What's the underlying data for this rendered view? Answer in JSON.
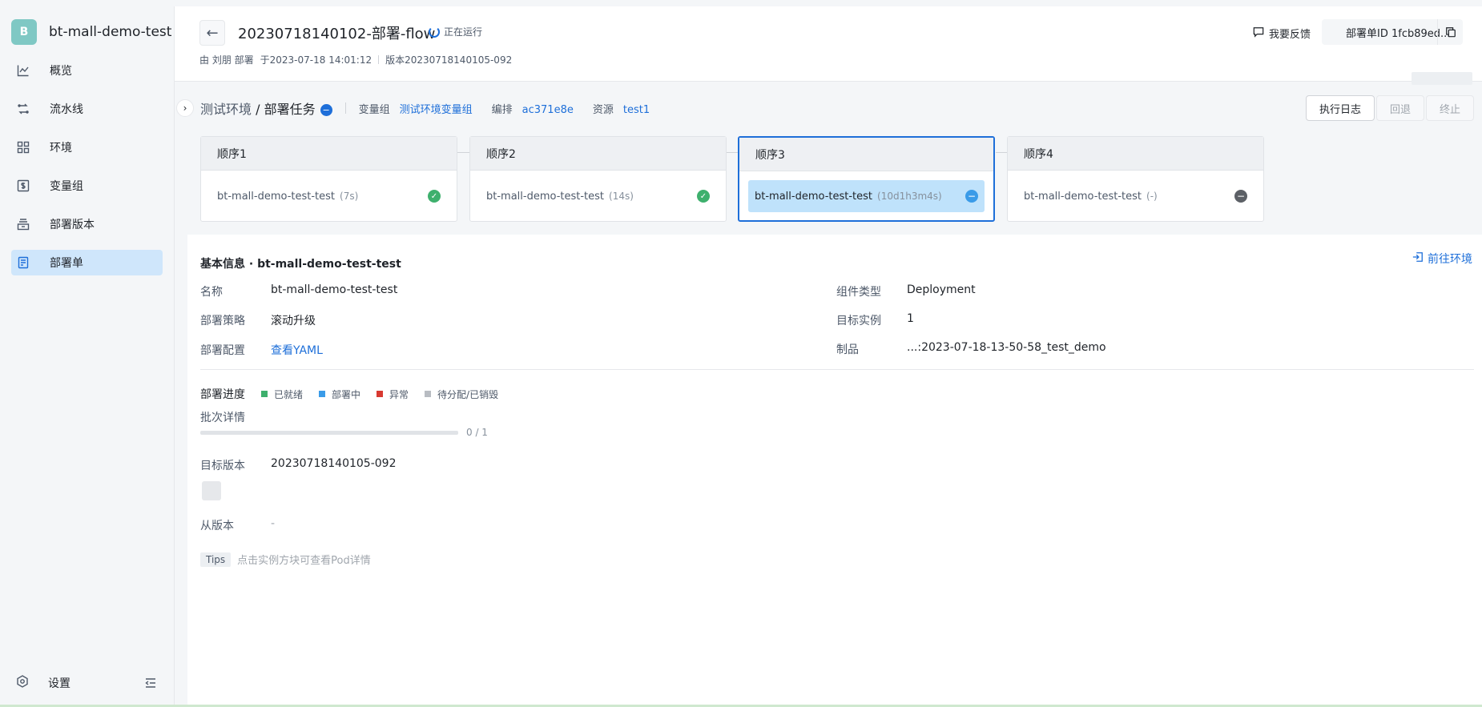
{
  "sidebar": {
    "brand_initial": "B",
    "brand_name": "bt-mall-demo-test",
    "items": [
      {
        "label": "概览",
        "icon": "line-chart-icon"
      },
      {
        "label": "流水线",
        "icon": "pipeline-icon"
      },
      {
        "label": "环境",
        "icon": "grid-icon"
      },
      {
        "label": "变量组",
        "icon": "variable-icon"
      },
      {
        "label": "部署版本",
        "icon": "package-icon"
      },
      {
        "label": "部署单",
        "icon": "document-icon"
      }
    ],
    "active_index": 5,
    "settings_label": "设置"
  },
  "header": {
    "title": "20230718140102-部署-flow",
    "status": "正在运行",
    "meta_by": "由 刘朋 部署",
    "meta_time": "于2023-07-18 14:01:12",
    "meta_version": "版本20230718140105-092",
    "feedback": "我要反馈",
    "deploy_id": "部署单ID 1fcb89ed..."
  },
  "taskbar": {
    "env": "测试环境",
    "slash": " / ",
    "task": "部署任务",
    "var_group_key": "变量组",
    "var_group_value": "测试环境变量组",
    "arrange_key": "编排",
    "arrange_value": "ac371e8e",
    "resource_key": "资源",
    "resource_value": "test1",
    "log_btn": "执行日志",
    "rollback_btn": "回退",
    "stop_btn": "终止"
  },
  "stages": [
    {
      "title": "顺序1",
      "job": "bt-mall-demo-test-test",
      "duration": "(7s)",
      "status": "success"
    },
    {
      "title": "顺序2",
      "job": "bt-mall-demo-test-test",
      "duration": "(14s)",
      "status": "success"
    },
    {
      "title": "顺序3",
      "job": "bt-mall-demo-test-test",
      "duration": "(10d1h3m4s)",
      "status": "running"
    },
    {
      "title": "顺序4",
      "job": "bt-mall-demo-test-test",
      "duration": "(-)",
      "status": "waiting"
    }
  ],
  "info": {
    "title": "基本信息 · bt-mall-demo-test-test",
    "goto": "前往环境",
    "name_key": "名称",
    "name_value": "bt-mall-demo-test-test",
    "strategy_key": "部署策略",
    "strategy_value": "滚动升级",
    "config_key": "部署配置",
    "config_value": "查看YAML",
    "comp_type_key": "组件类型",
    "comp_type_value": "Deployment",
    "target_key": "目标实例",
    "target_value": "1",
    "artifact_key": "制品",
    "artifact_value": "...:2023-07-18-13-50-58_test_demo"
  },
  "progress": {
    "title": "部署进度",
    "legend": [
      {
        "label": "已就绪",
        "color": "#3eb06d"
      },
      {
        "label": "部署中",
        "color": "#3a9be8"
      },
      {
        "label": "异常",
        "color": "#d83931"
      },
      {
        "label": "待分配/已销毁",
        "color": "#b8bcc2"
      }
    ],
    "batch_label": "批次详情",
    "ready": 0,
    "total": 1,
    "ratio_text": "0 / 1",
    "target_version_key": "目标版本",
    "target_version_value": "20230718140105-092",
    "from_version_key": "从版本",
    "from_version_value": "-",
    "tips_tag": "Tips",
    "tips_text": "点击实例方块可查看Pod详情"
  }
}
